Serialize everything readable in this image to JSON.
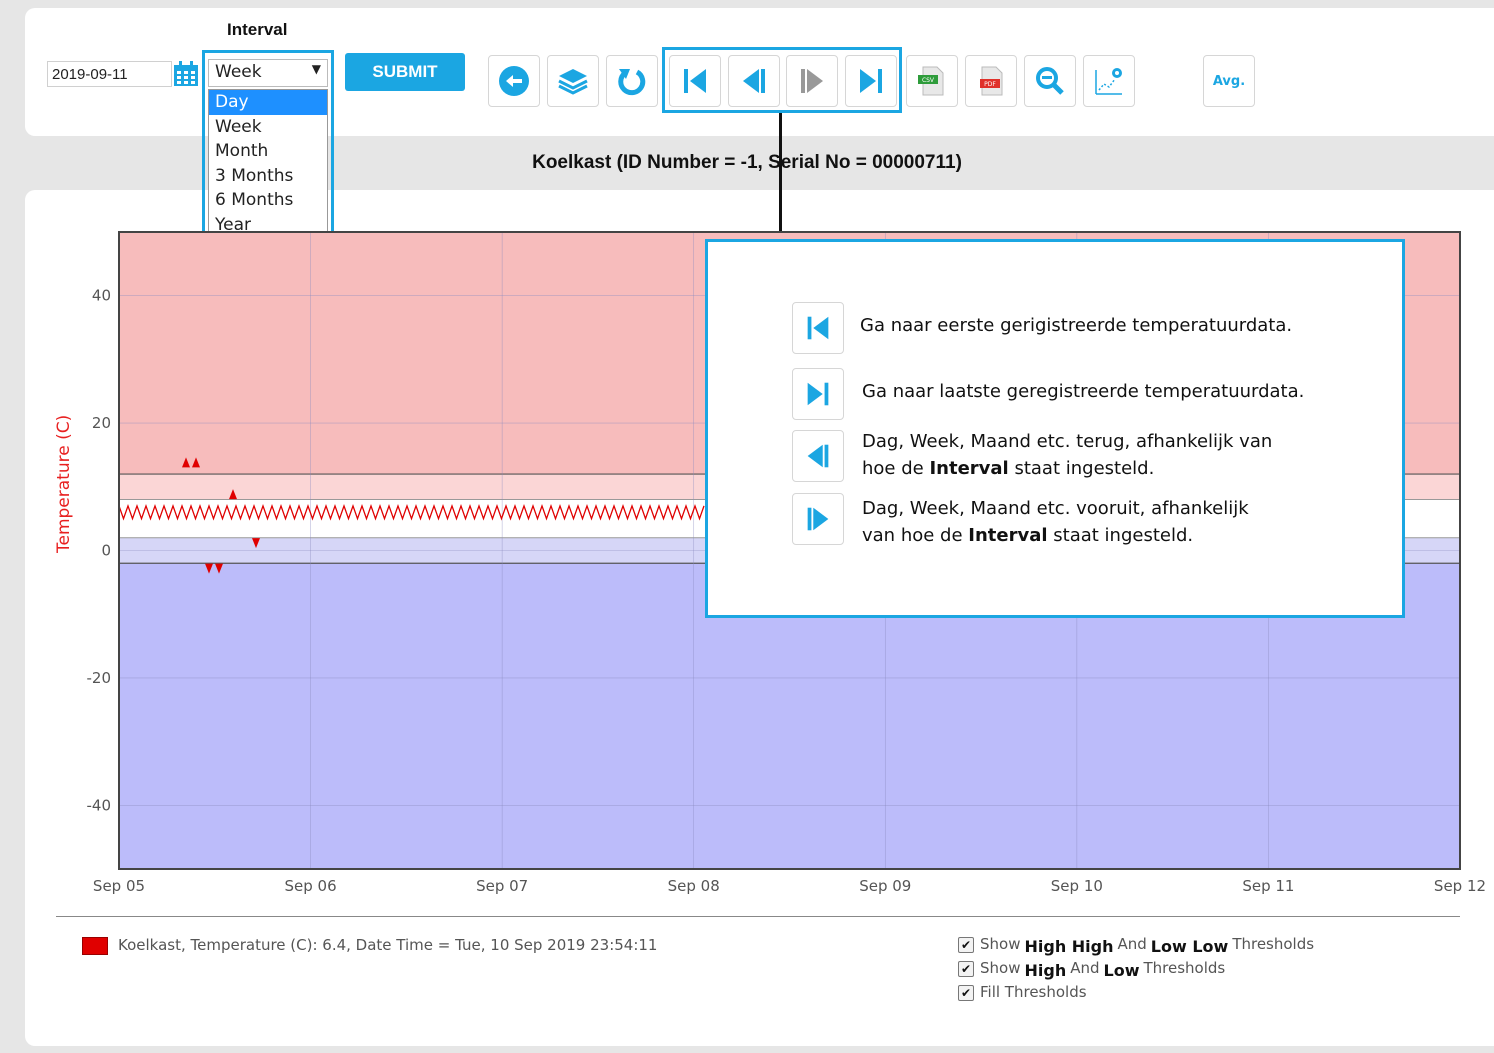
{
  "toolbar": {
    "interval_label": "Interval",
    "date_value": "2019-09-11",
    "interval_selected": "Week",
    "interval_options": [
      "Day",
      "Week",
      "Month",
      "3 Months",
      "6 Months",
      "Year"
    ],
    "submit_label": "SUBMIT",
    "avg_label": "Avg.",
    "csv_label": "CSV",
    "pdf_label": "PDF"
  },
  "chart_title": "Koelkast (ID Number = -1, Serial No = 00000711)",
  "chart_data": {
    "type": "line",
    "ylabel": "Temperature (C)",
    "ylim": [
      -50,
      50
    ],
    "x_tick_labels": [
      "Sep 05",
      "Sep 06",
      "Sep 07",
      "Sep 08",
      "Sep 09",
      "Sep 10",
      "Sep 11",
      "Sep 12"
    ],
    "y_tick_labels": [
      "40",
      "20",
      "0",
      "-20",
      "-40"
    ],
    "y_ticks": [
      40,
      20,
      0,
      -20,
      -40
    ],
    "thresholds": {
      "high_high": 12,
      "high": 8,
      "low": 2,
      "low_low": -2
    },
    "series": [
      {
        "name": "Koelkast, Temperature (C)",
        "pattern": "oscillating",
        "min": 5,
        "max": 7,
        "color": "#e00000"
      }
    ],
    "alarm_markers_up": [
      14,
      14,
      9
    ],
    "alarm_markers_down": [
      1,
      -3,
      -3
    ],
    "colors": {
      "above_high": "#f7bcbc",
      "high_band": "#fbd6d6",
      "normal_band": "#ffffff",
      "low_band": "#d6d6f7",
      "below_low": "#bcbcfa",
      "series": "#e00000"
    }
  },
  "help": {
    "first_text": "Ga naar eerste gerigistreerde temperatuurdata.",
    "last_text": "Ga naar laatste geregistreerde temperatuurdata.",
    "back_line1": "Dag, Week, Maand etc. terug, afhankelijk van",
    "back_line2_pre": "hoe de",
    "back_bold": "Interval",
    "back_line2_post": "staat ingesteld.",
    "fwd_line1": "Dag, Week, Maand etc. vooruit, afhankelijk",
    "fwd_line2_pre": "van hoe de",
    "fwd_bold": "Interval",
    "fwd_line2_post": "staat ingesteld."
  },
  "legend": {
    "text": "Koelkast, Temperature (C): 6.4, Date Time = Tue, 10 Sep 2019 23:54:11"
  },
  "checkboxes": {
    "hh_pre": "Show",
    "hh_b1": "High High",
    "hh_and": "And",
    "hh_b2": "Low Low",
    "hh_post": "Thresholds",
    "h_pre": "Show",
    "h_b1": "High",
    "h_and": "And",
    "h_b2": "Low",
    "h_post": "Thresholds",
    "fill": "Fill Thresholds"
  }
}
